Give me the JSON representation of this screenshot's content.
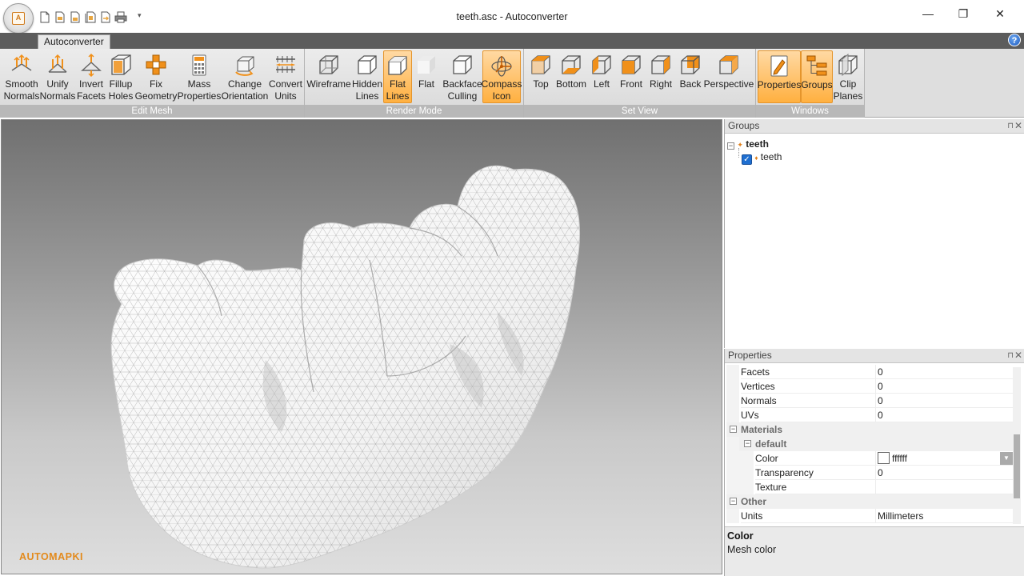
{
  "window": {
    "title": "teeth.asc - Autoconverter",
    "minimize": "—",
    "maximize": "❐",
    "close": "✕"
  },
  "app_orb": {
    "letter": "A"
  },
  "quick_access": {
    "icons": [
      "new-file-icon",
      "open-file-icon",
      "save-file-icon",
      "save-as-icon",
      "export-icon",
      "print-icon"
    ],
    "menu_glyph": "▾"
  },
  "ribbon": {
    "tab": "Autoconverter",
    "help": "?",
    "groups": [
      {
        "caption": "Edit Mesh"
      },
      {
        "caption": "Render Mode"
      },
      {
        "caption": "Set View"
      },
      {
        "caption": "Windows"
      }
    ],
    "edit_mesh": [
      {
        "l1": "Smooth",
        "l2": "Normals"
      },
      {
        "l1": "Unify",
        "l2": "Normals"
      },
      {
        "l1": "Invert",
        "l2": "Facets"
      },
      {
        "l1": "Fillup",
        "l2": "Holes"
      },
      {
        "l1": "Fix",
        "l2": "Geometry"
      },
      {
        "l1": "Mass",
        "l2": "Properties"
      },
      {
        "l1": "Change",
        "l2": "Orientation"
      },
      {
        "l1": "Convert",
        "l2": "Units"
      }
    ],
    "render_mode": [
      {
        "l1": "Wireframe",
        "l2": ""
      },
      {
        "l1": "Hidden",
        "l2": "Lines"
      },
      {
        "l1": "Flat",
        "l2": "Lines"
      },
      {
        "l1": "Flat",
        "l2": ""
      },
      {
        "l1": "Backface",
        "l2": "Culling"
      },
      {
        "l1": "Compass",
        "l2": "Icon"
      }
    ],
    "set_view": [
      {
        "l1": "Top"
      },
      {
        "l1": "Bottom"
      },
      {
        "l1": "Left"
      },
      {
        "l1": "Front"
      },
      {
        "l1": "Right"
      },
      {
        "l1": "Back"
      },
      {
        "l1": "Perspective"
      }
    ],
    "windows": [
      {
        "l1": "Properties",
        "l2": ""
      },
      {
        "l1": "Groups",
        "l2": ""
      },
      {
        "l1": "Clip",
        "l2": "Planes"
      }
    ]
  },
  "viewport": {
    "watermark": "AUTOMAPKI"
  },
  "groups_panel": {
    "title": "Groups",
    "pin": "⊓",
    "close": "✕",
    "root": "teeth",
    "child": "teeth",
    "child_checked": true
  },
  "properties_panel": {
    "title": "Properties",
    "pin": "⊓",
    "close": "✕",
    "rows": {
      "facets": {
        "name": "Facets",
        "value": "0"
      },
      "vertices": {
        "name": "Vertices",
        "value": "0"
      },
      "normals": {
        "name": "Normals",
        "value": "0"
      },
      "uvs": {
        "name": "UVs",
        "value": "0"
      },
      "materials": {
        "name": "Materials"
      },
      "default": {
        "name": "default"
      },
      "color": {
        "name": "Color",
        "value": "ffffff"
      },
      "transparency": {
        "name": "Transparency",
        "value": "0"
      },
      "texture": {
        "name": "Texture",
        "value": ""
      },
      "other": {
        "name": "Other"
      },
      "units": {
        "name": "Units",
        "value": "Millimeters"
      }
    },
    "description": {
      "title": "Color",
      "text": "Mesh color"
    }
  },
  "colors": {
    "accent": "#ffb040",
    "watermark": "#e38a1c",
    "ribbon_caption": "#b8b8b8"
  }
}
